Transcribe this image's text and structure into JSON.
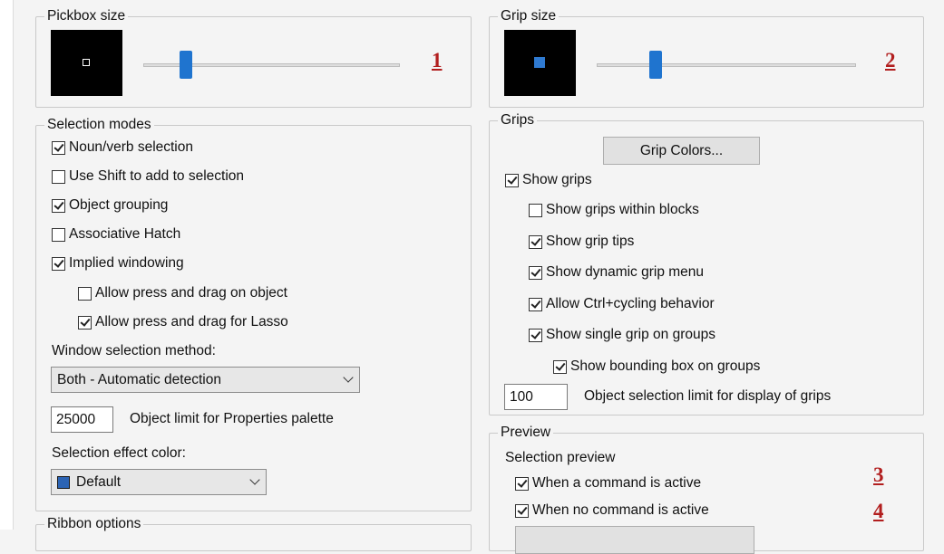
{
  "pickbox": {
    "title": "Pickbox size",
    "slider_value": 0.2,
    "annotation": "1"
  },
  "grip_size": {
    "title": "Grip size",
    "slider_value": 0.22,
    "annotation": "2"
  },
  "selection_modes": {
    "title": "Selection modes",
    "options": [
      {
        "label": "Noun/verb selection",
        "checked": true
      },
      {
        "label": "Use Shift to add to selection",
        "checked": false
      },
      {
        "label": "Object grouping",
        "checked": true
      },
      {
        "label": "Associative Hatch",
        "checked": false
      },
      {
        "label": "Implied windowing",
        "checked": true
      },
      {
        "label": "Allow press and drag on object",
        "checked": false
      },
      {
        "label": "Allow press and drag for Lasso",
        "checked": true
      }
    ],
    "window_method_label": "Window selection method:",
    "window_method_value": "Both - Automatic detection",
    "object_limit_value": "25000",
    "object_limit_label": "Object limit for Properties palette",
    "effect_color_label": "Selection effect color:",
    "effect_color_value": "Default",
    "effect_color_swatch": "#2c64b4"
  },
  "ribbon_options": {
    "title": "Ribbon options"
  },
  "grips": {
    "title": "Grips",
    "grip_colors_button": "Grip Colors...",
    "options": [
      {
        "label": "Show grips",
        "checked": true
      },
      {
        "label": "Show grips within blocks",
        "checked": false
      },
      {
        "label": "Show grip tips",
        "checked": true
      },
      {
        "label": "Show dynamic grip menu",
        "checked": true
      },
      {
        "label": "Allow Ctrl+cycling behavior",
        "checked": true
      },
      {
        "label": "Show single grip on groups",
        "checked": true
      },
      {
        "label": "Show bounding box on groups",
        "checked": true
      }
    ],
    "limit_value": "100",
    "limit_label": "Object selection limit for display of grips"
  },
  "preview": {
    "title": "Preview",
    "subtitle": "Selection preview",
    "options": [
      {
        "label": "When a command is active",
        "checked": true,
        "annotation": "3"
      },
      {
        "label": "When no command is active",
        "checked": true,
        "annotation": "4"
      }
    ]
  },
  "colors": {
    "accent": "#1f74cf",
    "annotation": "#b21e1e",
    "preview_bg": "#000000"
  }
}
